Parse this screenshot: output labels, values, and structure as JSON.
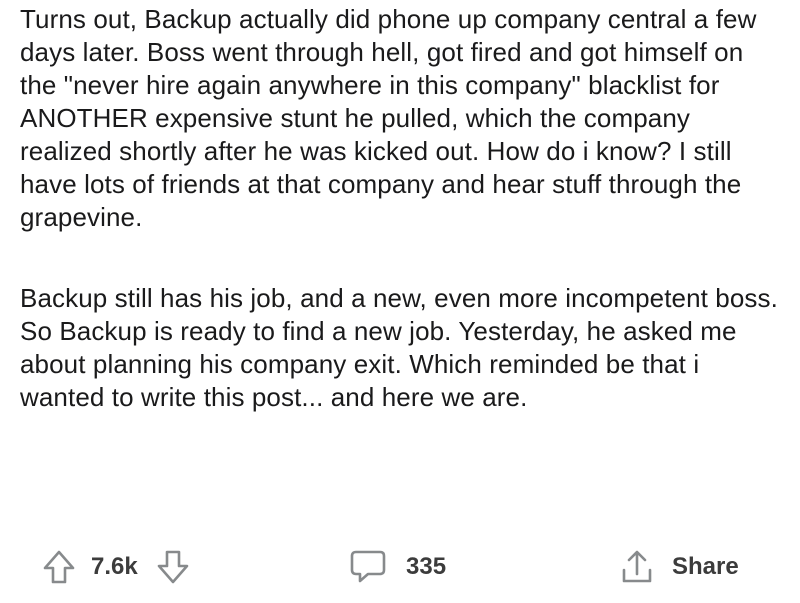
{
  "post": {
    "paragraphs": [
      "Turns out, Backup actually did phone up company central a few days later. Boss went through hell, got fired and got himself on the \"never hire again anywhere in this company\" blacklist for ANOTHER expensive stunt he pulled, which the company realized shortly after he was kicked out. How do i know? I still have lots of friends at that company and hear stuff through the grapevine.",
      "Backup still has his job, and a new, even more incompetent boss. So Backup is ready to find a new job. Yesterday, he asked me about planning his company exit. Which reminded be that i wanted to write this post... and here we are."
    ]
  },
  "actions": {
    "upvote_icon": "arrow-up-outline-icon",
    "downvote_icon": "arrow-down-outline-icon",
    "vote_count": "7.6k",
    "comment_icon": "speech-bubble-icon",
    "comment_count": "335",
    "share_icon": "share-arrow-icon",
    "share_label": "Share"
  },
  "colors": {
    "text": "#1a1a1b",
    "icon": "#878a8c",
    "background": "#ffffff"
  }
}
